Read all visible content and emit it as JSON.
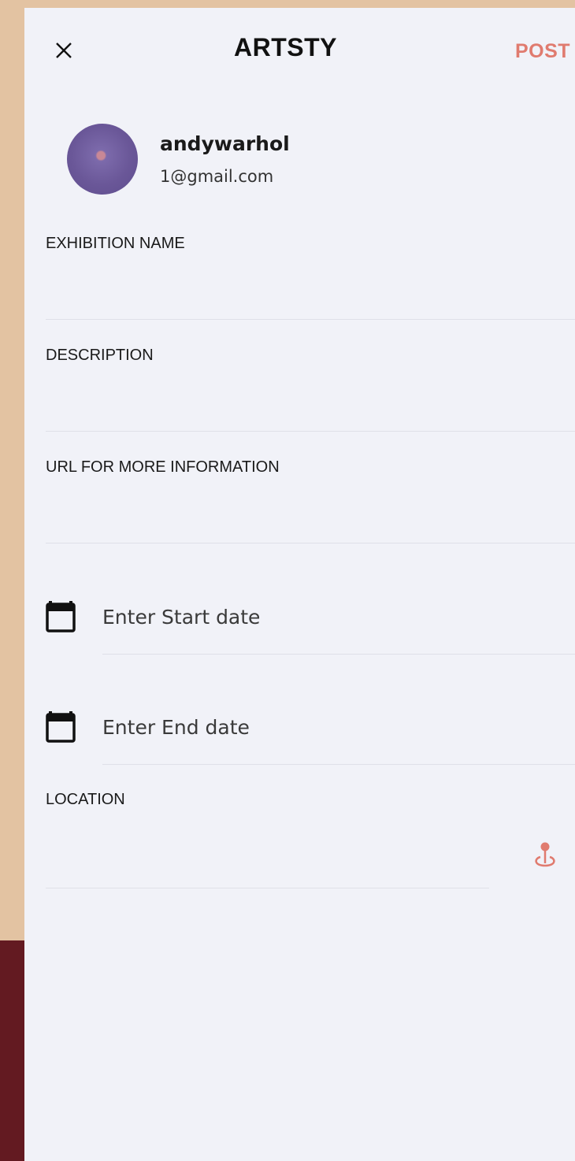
{
  "header": {
    "close_icon": "close-icon",
    "title": "ARTSTY",
    "post_label": "POST"
  },
  "profile": {
    "username": "andywarhol",
    "email": "1@gmail.com"
  },
  "fields": {
    "exhibition_name_label": "EXHIBITION NAME",
    "exhibition_name_value": "",
    "description_label": "DESCRIPTION",
    "description_value": "",
    "url_label": "URL FOR MORE INFORMATION",
    "url_value": "",
    "start_date_placeholder": "Enter Start date",
    "end_date_placeholder": "Enter End date",
    "location_label": "LOCATION",
    "location_value": ""
  },
  "icons": {
    "calendar": "calendar-icon",
    "location": "location-pin-icon"
  },
  "colors": {
    "accent": "#e07b6f",
    "sheet_bg": "#f1f2f8",
    "bg_top": "#e3c3a2",
    "bg_bottom": "#631a21"
  }
}
